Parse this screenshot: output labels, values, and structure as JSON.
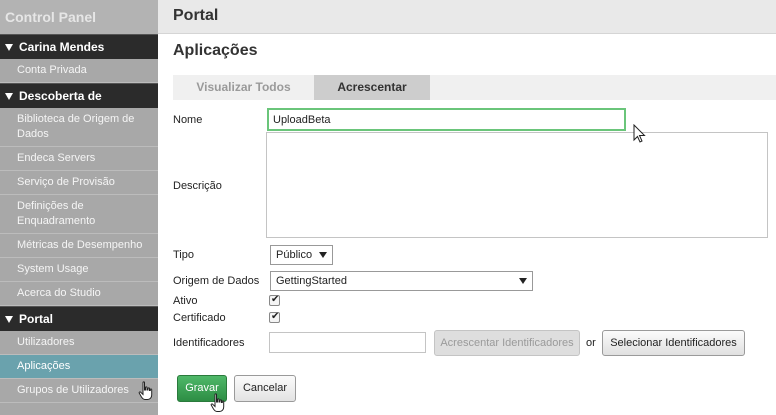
{
  "sidebar": {
    "title": "Control Panel",
    "sections": [
      {
        "label": "Carina Mendes",
        "items": [
          {
            "label": "Conta Privada"
          }
        ]
      },
      {
        "label": "Descoberta de",
        "items": [
          {
            "label": "Biblioteca de Origem de Dados"
          },
          {
            "label": "Endeca Servers"
          },
          {
            "label": "Serviço de Provisão"
          },
          {
            "label": "Definições de Enquadramento"
          },
          {
            "label": "Métricas de Desempenho"
          },
          {
            "label": "System Usage"
          },
          {
            "label": "Acerca do Studio"
          }
        ]
      },
      {
        "label": "Portal",
        "items": [
          {
            "label": "Utilizadores"
          },
          {
            "label": "Aplicações",
            "active": true
          },
          {
            "label": "Grupos de Utilizadores"
          }
        ]
      }
    ]
  },
  "header": {
    "title": "Portal"
  },
  "page": {
    "heading": "Aplicações"
  },
  "tabs": [
    {
      "label": "Visualizar Todos",
      "selected": false
    },
    {
      "label": "Acrescentar",
      "selected": true
    }
  ],
  "form": {
    "name_label": "Nome",
    "name_value": "UploadBeta",
    "description_label": "Descrição",
    "description_value": "",
    "type_label": "Tipo",
    "type_value": "Público",
    "source_label": "Origem de Dados",
    "source_value": "GettingStarted",
    "active_label": "Ativo",
    "active_checked": true,
    "certified_label": "Certificado",
    "certified_checked": true,
    "identifiers_label": "Identificadores",
    "identifiers_value": "",
    "add_identifiers_label": "Acrescentar Identificadores",
    "or_text": "or",
    "select_identifiers_label": "Selecionar Identificadores"
  },
  "actions": {
    "save_label": "Gravar",
    "cancel_label": "Cancelar"
  },
  "colors": {
    "sidebar_bg": "#a8a8a8",
    "sidebar_header_bg": "#2b2b2b",
    "active_item_bg": "#6aa2ad",
    "save_button": "#3aa155",
    "focus_border": "#6ac57a"
  },
  "icons": {
    "section_toggle": "triangle-down-icon",
    "checkbox_mark": "check-icon",
    "select_caret": "caret-down-icon"
  }
}
